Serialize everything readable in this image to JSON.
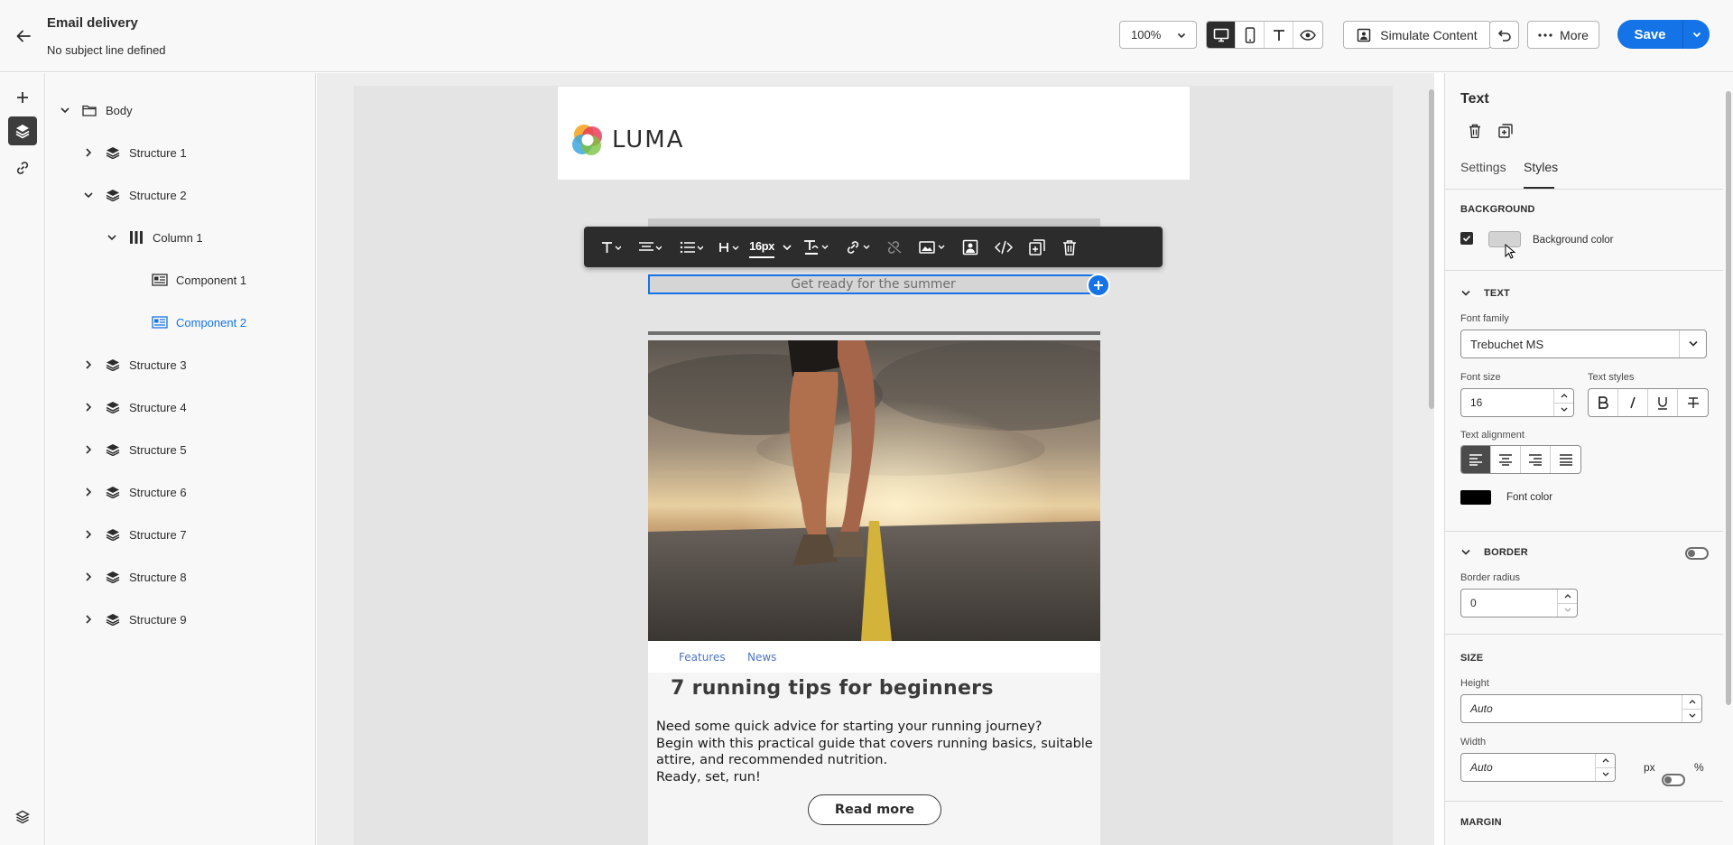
{
  "header": {
    "title": "Email delivery",
    "subtitle": "No subject line defined",
    "zoom": "100%",
    "simulate_label": "Simulate Content",
    "more_label": "More",
    "save_label": "Save"
  },
  "tree": {
    "body": "Body",
    "structure_1": "Structure 1",
    "structure_2": "Structure 2",
    "column_1": "Column 1",
    "component_1": "Component 1",
    "component_2": "Component 2",
    "structure_3": "Structure 3",
    "structure_4": "Structure 4",
    "structure_5": "Structure 5",
    "structure_6": "Structure 6",
    "structure_7": "Structure 7",
    "structure_8": "Structure 8",
    "structure_9": "Structure 9"
  },
  "email": {
    "logo_text": "LUMA",
    "toolbar_font_size": "16px",
    "selected_text": "Get ready for the summer",
    "tag_1": "Features",
    "tag_2": "News",
    "article_title": "7 running tips for beginners",
    "article_line_1": "Need some quick advice for starting your running journey?",
    "article_line_2": "Begin with this practical guide that covers running basics, suitable",
    "article_line_3": "attire, and recommended nutrition.",
    "article_line_4": "Ready, set, run!",
    "read_more": "Read more"
  },
  "props": {
    "title": "Text",
    "tab_settings": "Settings",
    "tab_styles": "Styles",
    "background_section": "BACKGROUND",
    "background_color_label": "Background color",
    "background_color": "#d3d3d3",
    "text_section": "TEXT",
    "font_family_label": "Font family",
    "font_family_value": "Trebuchet MS",
    "font_size_label": "Font size",
    "font_size_value": "16",
    "text_styles_label": "Text styles",
    "text_alignment_label": "Text alignment",
    "font_color_label": "Font color",
    "font_color": "#000000",
    "border_section": "BORDER",
    "border_radius_label": "Border radius",
    "border_radius_value": "0",
    "size_section": "SIZE",
    "height_label": "Height",
    "height_value": "Auto",
    "width_label": "Width",
    "width_value": "Auto",
    "width_unit_px": "px",
    "width_unit_pct": "%",
    "margin_section": "MARGIN"
  },
  "colors": {
    "accent": "#1473e6"
  }
}
